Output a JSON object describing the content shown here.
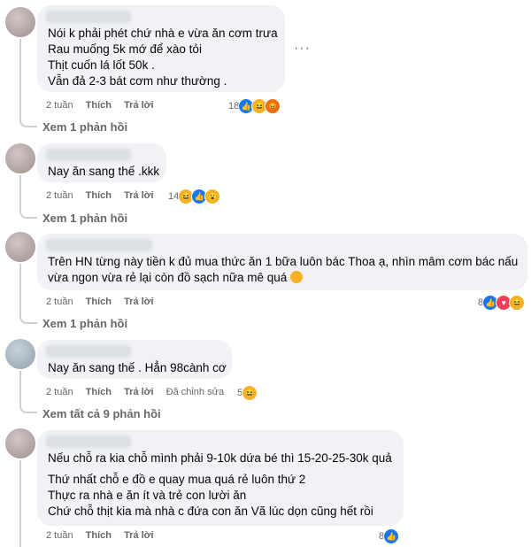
{
  "comments": [
    {
      "lines": [
        "Nói k phải phét chứ nhà e vừa ăn cơm trưa",
        "Rau muống 5k mớ để xào tỏi",
        "Thịt cuốn lá lốt 50k .",
        "Vẫn đả 2-3 bát cơm như thường ."
      ],
      "time": "2 tuần",
      "like": "Thích",
      "reply": "Trả lời",
      "reaction_count": "18",
      "reaction_icons": [
        "like-icon",
        "haha-icon",
        "angry-icon"
      ],
      "replies_link": "Xem 1 phản hồi",
      "more": "···"
    },
    {
      "lines": [
        "Nay ăn sang thế .kkk"
      ],
      "time": "2 tuần",
      "like": "Thích",
      "reply": "Trả lời",
      "reaction_count": "14",
      "reaction_icons": [
        "haha-icon",
        "like-icon",
        "wow-icon"
      ],
      "replies_link": "Xem 1 phản hồi"
    },
    {
      "lines": [
        "Trên HN từng này tiền k đủ mua thức ăn 1 bữa luôn bác Thoa ạ, nhìn mâm cơm bác nấu",
        "vừa ngon vừa rẻ lại còn đồ sạch nữa mê quá"
      ],
      "time": "2 tuần",
      "like": "Thích",
      "reply": "Trả lời",
      "reaction_count": "8",
      "reaction_icons": [
        "like-icon",
        "love-icon",
        "haha-icon"
      ],
      "replies_link": "Xem 1 phản hồi"
    },
    {
      "lines": [
        "Nay ăn sang thế . Hẳn 98cành cơ"
      ],
      "time": "2 tuần",
      "like": "Thích",
      "reply": "Trả lời",
      "edited": "Đã chỉnh sửa",
      "reaction_count": "5",
      "reaction_icons": [
        "haha-icon"
      ],
      "replies_link": "Xem tất cả 9 phản hồi"
    },
    {
      "lines": [
        "Nếu chỗ ra kia chỗ mình phải 9-10k dứa bé thì 15-20-25-30k quả",
        "",
        "Thứ nhất chỗ e đồ e quay mua quá rẻ luôn thứ 2",
        "Thực ra nhà e ăn ít và trẻ con lười ăn",
        "Chứ chỗ thịt kia mà nhà c đứa con ăn Vã lúc dọn cũng hết rồi"
      ],
      "time": "2 tuần",
      "like": "Thích",
      "reply": "Trả lời",
      "reaction_count": "8",
      "reaction_icons": [
        "like-icon"
      ]
    }
  ]
}
